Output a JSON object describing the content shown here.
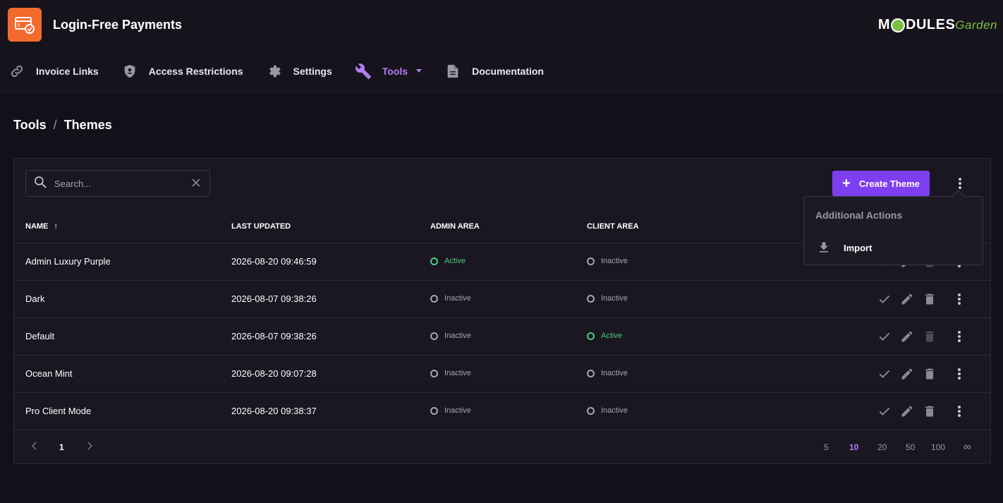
{
  "app": {
    "title": "Login-Free Payments",
    "brand_left": "M",
    "brand_mid": "DULES",
    "brand_right": "Garden"
  },
  "nav": [
    {
      "label": "Invoice Links",
      "icon": "link-icon"
    },
    {
      "label": "Access Restrictions",
      "icon": "shield-user-icon"
    },
    {
      "label": "Settings",
      "icon": "gear-icon"
    },
    {
      "label": "Tools",
      "icon": "wrench-icon",
      "active": true
    },
    {
      "label": "Documentation",
      "icon": "document-icon"
    }
  ],
  "breadcrumb": {
    "parent": "Tools",
    "separator": "/",
    "current": "Themes"
  },
  "search": {
    "placeholder": "Search...",
    "value": ""
  },
  "toolbar": {
    "create_label": "Create Theme"
  },
  "table": {
    "headers": {
      "name": "NAME",
      "name_sort": "↑",
      "last_updated": "LAST UPDATED",
      "admin_area": "ADMIN AREA",
      "client_area": "CLIENT AREA"
    },
    "rows": [
      {
        "name": "Admin Luxury Purple",
        "updated": "2026-08-20 09:46:59",
        "admin": "Active",
        "client": "Inactive"
      },
      {
        "name": "Dark",
        "updated": "2026-08-07 09:38:26",
        "admin": "Inactive",
        "client": "Inactive"
      },
      {
        "name": "Default",
        "updated": "2026-08-07 09:38:26",
        "admin": "Inactive",
        "client": "Active"
      },
      {
        "name": "Ocean Mint",
        "updated": "2026-08-20 09:07:28",
        "admin": "Inactive",
        "client": "Inactive"
      },
      {
        "name": "Pro Client Mode",
        "updated": "2026-08-20 09:38:37",
        "admin": "Inactive",
        "client": "Inactive"
      }
    ]
  },
  "pagination": {
    "current_page": "1",
    "page_sizes": [
      "5",
      "10",
      "20",
      "50",
      "100",
      "∞"
    ],
    "selected_size": "10"
  },
  "dropdown": {
    "title": "Additional Actions",
    "items": [
      {
        "label": "Import",
        "icon": "download-icon"
      }
    ]
  },
  "colors": {
    "accent": "#7d3ef0",
    "accent_text": "#b37cf5",
    "active_status": "#4dc97f",
    "app_icon_bg": "#f26b2d",
    "brand_green": "#7ac142"
  }
}
